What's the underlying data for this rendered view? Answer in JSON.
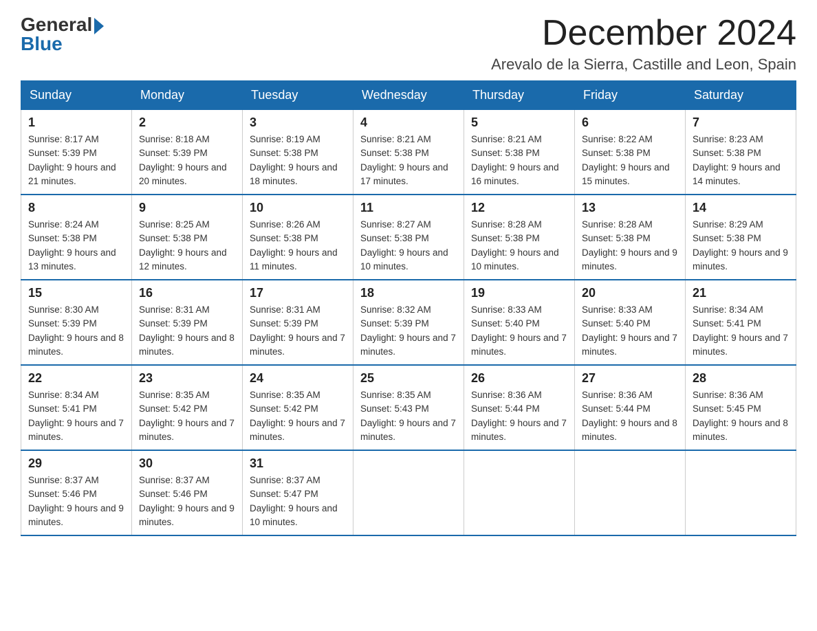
{
  "logo": {
    "text1": "General",
    "text2": "Blue"
  },
  "header": {
    "month_year": "December 2024",
    "location": "Arevalo de la Sierra, Castille and Leon, Spain"
  },
  "weekdays": [
    "Sunday",
    "Monday",
    "Tuesday",
    "Wednesday",
    "Thursday",
    "Friday",
    "Saturday"
  ],
  "weeks": [
    [
      {
        "day": "1",
        "sunrise": "8:17 AM",
        "sunset": "5:39 PM",
        "daylight": "9 hours and 21 minutes."
      },
      {
        "day": "2",
        "sunrise": "8:18 AM",
        "sunset": "5:39 PM",
        "daylight": "9 hours and 20 minutes."
      },
      {
        "day": "3",
        "sunrise": "8:19 AM",
        "sunset": "5:38 PM",
        "daylight": "9 hours and 18 minutes."
      },
      {
        "day": "4",
        "sunrise": "8:21 AM",
        "sunset": "5:38 PM",
        "daylight": "9 hours and 17 minutes."
      },
      {
        "day": "5",
        "sunrise": "8:21 AM",
        "sunset": "5:38 PM",
        "daylight": "9 hours and 16 minutes."
      },
      {
        "day": "6",
        "sunrise": "8:22 AM",
        "sunset": "5:38 PM",
        "daylight": "9 hours and 15 minutes."
      },
      {
        "day": "7",
        "sunrise": "8:23 AM",
        "sunset": "5:38 PM",
        "daylight": "9 hours and 14 minutes."
      }
    ],
    [
      {
        "day": "8",
        "sunrise": "8:24 AM",
        "sunset": "5:38 PM",
        "daylight": "9 hours and 13 minutes."
      },
      {
        "day": "9",
        "sunrise": "8:25 AM",
        "sunset": "5:38 PM",
        "daylight": "9 hours and 12 minutes."
      },
      {
        "day": "10",
        "sunrise": "8:26 AM",
        "sunset": "5:38 PM",
        "daylight": "9 hours and 11 minutes."
      },
      {
        "day": "11",
        "sunrise": "8:27 AM",
        "sunset": "5:38 PM",
        "daylight": "9 hours and 10 minutes."
      },
      {
        "day": "12",
        "sunrise": "8:28 AM",
        "sunset": "5:38 PM",
        "daylight": "9 hours and 10 minutes."
      },
      {
        "day": "13",
        "sunrise": "8:28 AM",
        "sunset": "5:38 PM",
        "daylight": "9 hours and 9 minutes."
      },
      {
        "day": "14",
        "sunrise": "8:29 AM",
        "sunset": "5:38 PM",
        "daylight": "9 hours and 9 minutes."
      }
    ],
    [
      {
        "day": "15",
        "sunrise": "8:30 AM",
        "sunset": "5:39 PM",
        "daylight": "9 hours and 8 minutes."
      },
      {
        "day": "16",
        "sunrise": "8:31 AM",
        "sunset": "5:39 PM",
        "daylight": "9 hours and 8 minutes."
      },
      {
        "day": "17",
        "sunrise": "8:31 AM",
        "sunset": "5:39 PM",
        "daylight": "9 hours and 7 minutes."
      },
      {
        "day": "18",
        "sunrise": "8:32 AM",
        "sunset": "5:39 PM",
        "daylight": "9 hours and 7 minutes."
      },
      {
        "day": "19",
        "sunrise": "8:33 AM",
        "sunset": "5:40 PM",
        "daylight": "9 hours and 7 minutes."
      },
      {
        "day": "20",
        "sunrise": "8:33 AM",
        "sunset": "5:40 PM",
        "daylight": "9 hours and 7 minutes."
      },
      {
        "day": "21",
        "sunrise": "8:34 AM",
        "sunset": "5:41 PM",
        "daylight": "9 hours and 7 minutes."
      }
    ],
    [
      {
        "day": "22",
        "sunrise": "8:34 AM",
        "sunset": "5:41 PM",
        "daylight": "9 hours and 7 minutes."
      },
      {
        "day": "23",
        "sunrise": "8:35 AM",
        "sunset": "5:42 PM",
        "daylight": "9 hours and 7 minutes."
      },
      {
        "day": "24",
        "sunrise": "8:35 AM",
        "sunset": "5:42 PM",
        "daylight": "9 hours and 7 minutes."
      },
      {
        "day": "25",
        "sunrise": "8:35 AM",
        "sunset": "5:43 PM",
        "daylight": "9 hours and 7 minutes."
      },
      {
        "day": "26",
        "sunrise": "8:36 AM",
        "sunset": "5:44 PM",
        "daylight": "9 hours and 7 minutes."
      },
      {
        "day": "27",
        "sunrise": "8:36 AM",
        "sunset": "5:44 PM",
        "daylight": "9 hours and 8 minutes."
      },
      {
        "day": "28",
        "sunrise": "8:36 AM",
        "sunset": "5:45 PM",
        "daylight": "9 hours and 8 minutes."
      }
    ],
    [
      {
        "day": "29",
        "sunrise": "8:37 AM",
        "sunset": "5:46 PM",
        "daylight": "9 hours and 9 minutes."
      },
      {
        "day": "30",
        "sunrise": "8:37 AM",
        "sunset": "5:46 PM",
        "daylight": "9 hours and 9 minutes."
      },
      {
        "day": "31",
        "sunrise": "8:37 AM",
        "sunset": "5:47 PM",
        "daylight": "9 hours and 10 minutes."
      },
      null,
      null,
      null,
      null
    ]
  ]
}
